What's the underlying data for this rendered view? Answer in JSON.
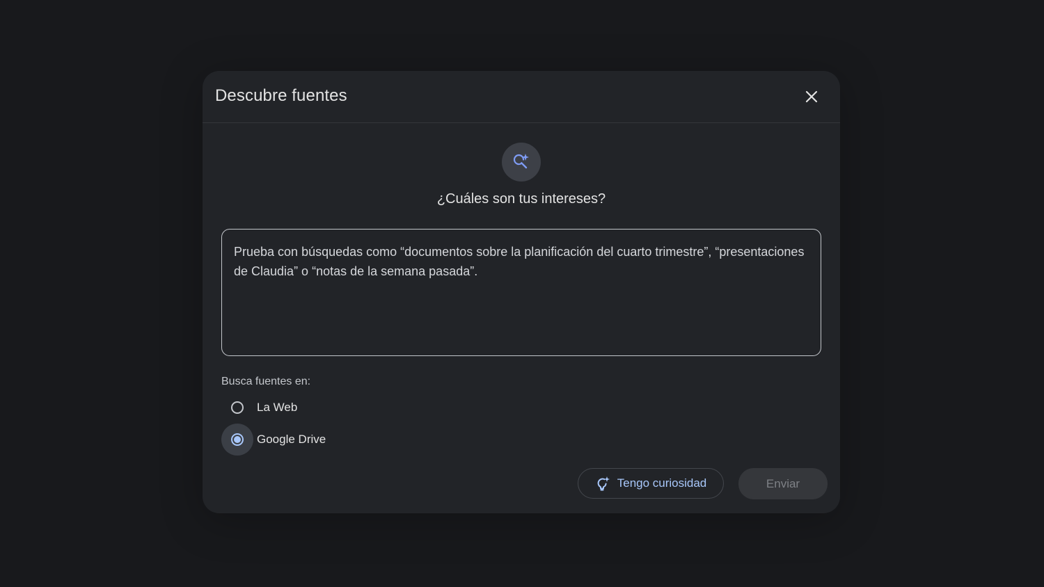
{
  "dialog": {
    "title": "Descubre fuentes",
    "close_icon": "close-icon"
  },
  "hero": {
    "icon": "search-sparkle-icon",
    "question": "¿Cuáles son tus intereses?"
  },
  "input": {
    "value": "",
    "placeholder": "Prueba con búsquedas como “documentos sobre la planificación del cuarto trimestre”, “presentaciones de Claudia” o “notas de la semana pasada”."
  },
  "sources": {
    "label": "Busca fuentes en:",
    "options": [
      {
        "label": "La Web",
        "selected": false
      },
      {
        "label": "Google Drive",
        "selected": true
      }
    ]
  },
  "actions": {
    "curious_icon": "lightbulb-sparkle-icon",
    "curious_label": "Tengo curiosidad",
    "send_label": "Enviar"
  },
  "colors": {
    "accent": "#a8c7fa",
    "background": "#18191c",
    "dialog": "#222428"
  }
}
